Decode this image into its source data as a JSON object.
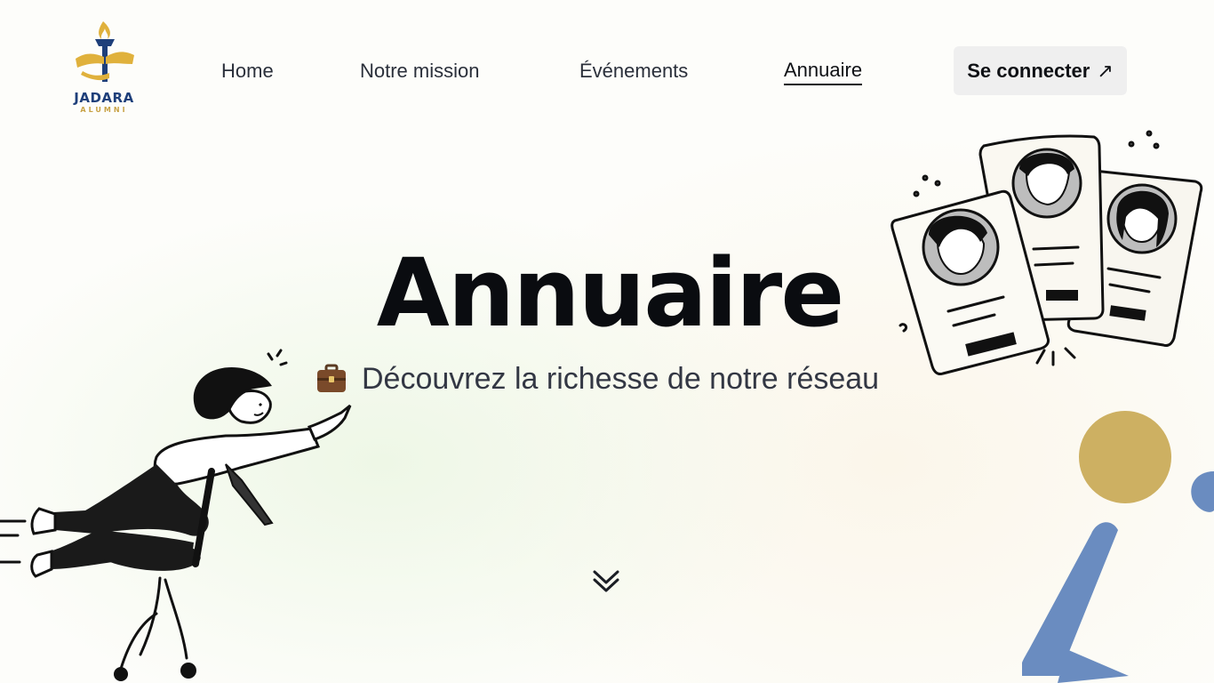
{
  "header": {
    "logo": {
      "brand": "JADARA",
      "sub": "ALUMNI"
    },
    "nav": [
      {
        "label": "Home",
        "active": false
      },
      {
        "label": "Notre mission",
        "active": false
      },
      {
        "label": "Événements",
        "active": false
      },
      {
        "label": "Annuaire",
        "active": true
      }
    ],
    "login": {
      "label": "Se connecter",
      "icon": "arrow-up-right-icon"
    }
  },
  "hero": {
    "title": "Annuaire",
    "subtitle_icon": "briefcase-icon",
    "subtitle": "Découvrez la richesse de notre réseau",
    "scroll_icon": "double-chevron-down-icon"
  },
  "colors": {
    "text": "#0f1115",
    "gold": "#c8a245",
    "navy": "#1e3f7a",
    "blue": "#6a8cc0",
    "button_bg": "#efefef"
  }
}
